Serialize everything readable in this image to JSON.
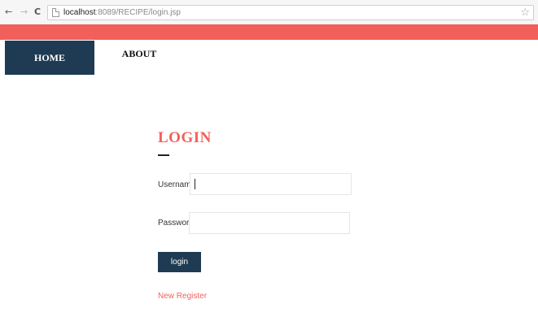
{
  "browser": {
    "back_glyph": "←",
    "forward_glyph": "→",
    "reload_glyph": "C",
    "url_host": "localhost",
    "url_rest": ":8089/RECIPE/login.jsp",
    "star_glyph": "☆"
  },
  "menu": {
    "items": [
      {
        "label": "HOME",
        "active": true
      },
      {
        "label": "ABOUT",
        "active": false
      }
    ]
  },
  "login": {
    "title": "LOGIN",
    "username_label": "Username :",
    "username_value": "",
    "password_label": "Password :",
    "password_value": "",
    "submit_label": "login",
    "register_link": "New Register"
  },
  "colors": {
    "accent": "#f2605b",
    "navy": "#1f3b53"
  }
}
